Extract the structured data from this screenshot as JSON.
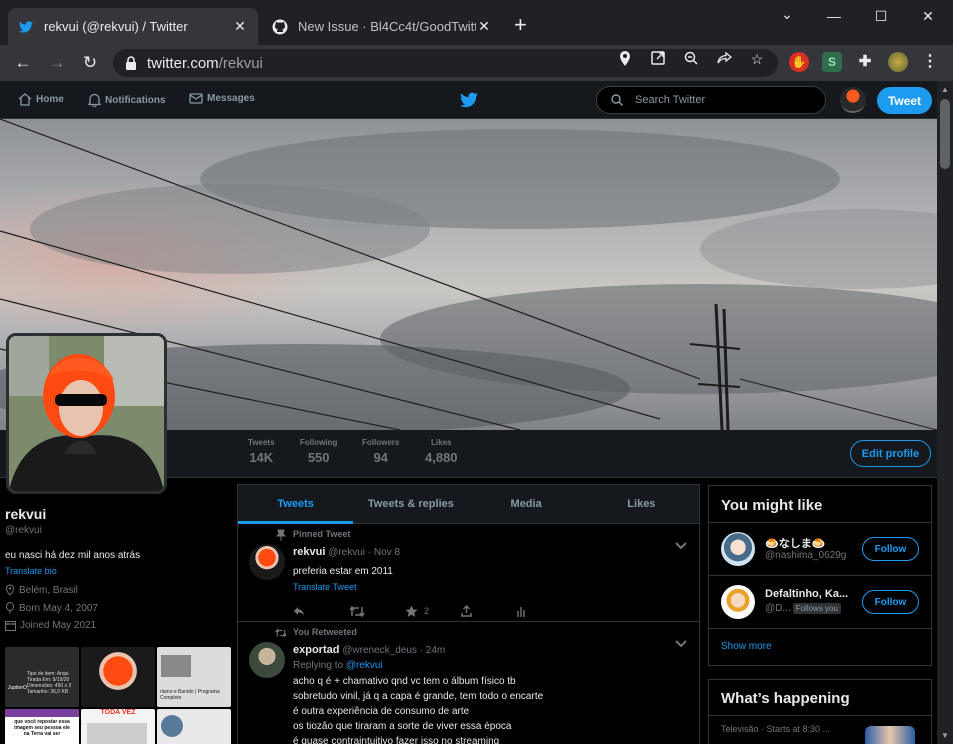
{
  "browser": {
    "tabs": [
      {
        "title": "rekvui (@rekvui) / Twitter",
        "close": "✕"
      },
      {
        "title": "New Issue · Bl4Cc4t/GoodTwitter",
        "close": "✕"
      }
    ],
    "new_tab": "+",
    "window_controls": {
      "chevron": "⌄",
      "minimize": "—",
      "maximize": "☐",
      "close": "✕"
    },
    "url_host": "twitter.com",
    "url_path": "/rekvui"
  },
  "nav": {
    "home": "Home",
    "notifications": "Notifications",
    "messages": "Messages",
    "search_placeholder": "Search Twitter",
    "tweet_button": "Tweet"
  },
  "stats": [
    {
      "label": "Tweets",
      "value": "14K"
    },
    {
      "label": "Following",
      "value": "550"
    },
    {
      "label": "Followers",
      "value": "94"
    },
    {
      "label": "Likes",
      "value": "4,880"
    }
  ],
  "edit_profile": "Edit profile",
  "profile": {
    "name": "rekvui",
    "handle": "@rekvui",
    "bio": "eu nasci há dez mil anos atrás",
    "translate_bio": "Translate bio",
    "location": "Belém, Brasil",
    "born": "Born May 4, 2007",
    "joined": "Joined May 2021"
  },
  "timeline": {
    "tabs": [
      "Tweets",
      "Tweets & replies",
      "Media",
      "Likes"
    ],
    "tweets": [
      {
        "context": "Pinned Tweet",
        "name": "rekvui",
        "handle": "@rekvui",
        "time": "Nov 8",
        "text": "preferia estar em 2011",
        "translate": "Translate Tweet",
        "likes": "2"
      },
      {
        "context": "You Retweeted",
        "name": "exportad",
        "handle": "@wreneck_deus",
        "time": "24m",
        "replying_prefix": "Replying to",
        "replying_to": "@rekvui",
        "text": "acho q é + chamativo qnd vc tem o álbum físico tb\nsobretudo vinil, já q a capa é grande, tem todo o encarte\né outra experiência de consumo de arte\nos tiozão que tiraram a sorte de viver essa época\né quase contraintuitivo fazer isso no streaming"
      }
    ]
  },
  "media_thumbs": {
    "t1_line1": "Tipo de item: Arqui",
    "t1_line2": "Tirada Em: 9/19/20",
    "t1_line3": "Dimensões: 450 x 3",
    "t1_line4": "Tamanho: 36,0 KB",
    "t1_tag": "JupiterO",
    "t3_caption": "rlamo e Banido | Programa Completo",
    "t4_text": "que você repostar essa imagem seu pessoa ele na Terra vai ser",
    "t5_banner": "TODA VEZ"
  },
  "might_like": {
    "title": "You might like",
    "users": [
      {
        "name": "🍮なしま🍮",
        "handle": "@nashima_0629g",
        "follows_you": "",
        "button": "Follow"
      },
      {
        "name": "Defaltinho, Ka...",
        "handle": "@D...",
        "follows_you": "Follows you",
        "button": "Follow"
      }
    ],
    "show_more": "Show more"
  },
  "happening": {
    "title": "What’s happening",
    "meta": "Televisão · Starts at 8:30 ..."
  },
  "colors": {
    "accent": "#1d9bf0",
    "background": "#000000",
    "panel": "#15181c",
    "border": "#2f3336"
  }
}
